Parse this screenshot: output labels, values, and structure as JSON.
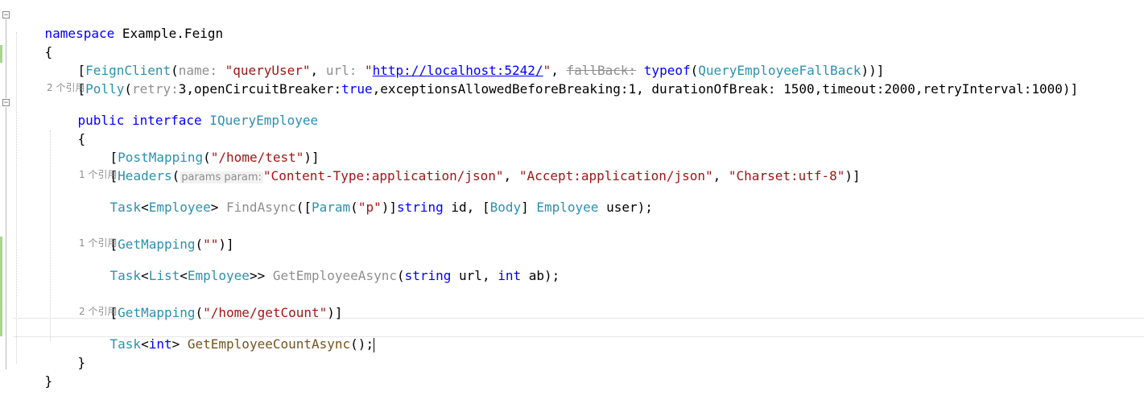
{
  "editor": {
    "lines": {
      "l1": {
        "kw": "namespace",
        "name": " Example.Feign"
      },
      "l2": {
        "brace": "{"
      },
      "l3": {
        "open": "[",
        "attr": "FeignClient",
        "paren_open": "(",
        "hint_name": "name: ",
        "name_val": "\"queryUser\"",
        "sep1": ", ",
        "hint_url": "url: ",
        "q1": "\"",
        "url_val": "http://localhost:5242/",
        "q2": "\"",
        "sep2": ", ",
        "hint_fallback": "fallBack:",
        "sp": " ",
        "typeof_kw": "typeof",
        "paren2": "(",
        "fallback_type": "QueryEmployeeFallBack",
        "close": "))]"
      },
      "l4": {
        "open": "[",
        "attr": "Polly",
        "paren_open": "(",
        "hint_retry": "retry:",
        "args": "3,openCircuitBreaker:",
        "true_kw": "true",
        "rest": ",exceptionsAllowedBeforeBreaking:1, durationOfBreak: 1500,timeout:2000,retryInterval:1000)]"
      },
      "lens1": "2 个引用",
      "l5": {
        "kw1": "public",
        "sp": " ",
        "kw2": "interface",
        "sp2": " ",
        "name": "IQueryEmployee"
      },
      "l6": {
        "brace": "{"
      },
      "l7": {
        "open": "[",
        "attr": "PostMapping",
        "p": "(",
        "val": "\"/home/test\"",
        "close": ")]"
      },
      "l8": {
        "open": "[",
        "attr": "Headers",
        "p": "(",
        "hint": "params param:",
        "v1": "\"Content-Type:application/json\"",
        "s1": ", ",
        "v2": "\"Accept:application/json\"",
        "s2": ", ",
        "v3": "\"Charset:utf-8\"",
        "close": ")]"
      },
      "lens2": "1 个引用",
      "l9": {
        "task": "Task",
        "lt": "<",
        "emp": "Employee",
        "gt": "> ",
        "method": "FindAsync",
        "p1": "([",
        "param_attr": "Param",
        "p2": "(",
        "pval": "\"p\"",
        "p3": ")]",
        "str_kw": "string",
        "id": " id, [",
        "body_attr": "Body",
        "b2": "] ",
        "emp2": "Employee",
        "user": " user);"
      },
      "l10": {
        "open": "[",
        "attr": "GetMapping",
        "p": "(",
        "val": "\"\"",
        "close": ")]"
      },
      "lens3": "1 个引用",
      "l11": {
        "task": "Task",
        "lt": "<",
        "list": "List",
        "lt2": "<",
        "emp": "Employee",
        "gt": ">> ",
        "method": "GetEmployeeAsync",
        "p1": "(",
        "str_kw": "string",
        "url": " url, ",
        "int_kw": "int",
        "rest": " ab);"
      },
      "l12": {
        "open": "[",
        "attr": "GetMapping",
        "p": "(",
        "val": "\"/home/getCount\"",
        "close": ")]"
      },
      "lens4": "2 个引用",
      "l13": {
        "task": "Task",
        "lt": "<",
        "int_kw": "int",
        "gt": "> ",
        "method": "GetEmployeeCountAsync",
        "rest": "();"
      },
      "l14": {
        "brace": "}"
      },
      "l15": {
        "brace": "}"
      }
    },
    "fold_glyph": "⊟",
    "colors": {
      "keyword": "#0000ff",
      "type": "#2b91af",
      "string": "#a31515",
      "method": "#74531f",
      "hint": "#8f8f8f",
      "change_bar": "#a6d68a"
    }
  }
}
